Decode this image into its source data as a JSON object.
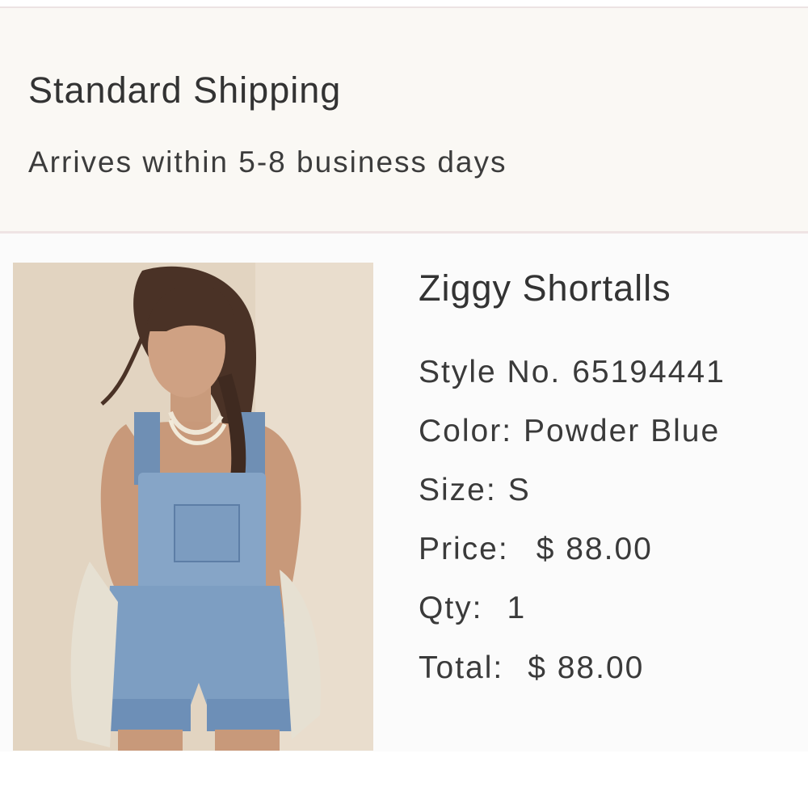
{
  "shipping": {
    "title": "Standard Shipping",
    "subtitle": "Arrives within 5-8 business days"
  },
  "product": {
    "name": "Ziggy Shortalls",
    "image": "model-wearing-denim-shortalls-photo",
    "style": {
      "label": "Style No.",
      "value": "65194441"
    },
    "color": {
      "label": "Color:",
      "value": "Powder Blue"
    },
    "size": {
      "label": "Size:",
      "value": "S"
    },
    "price": {
      "label": "Price:",
      "value": "$ 88.00"
    },
    "qty": {
      "label": "Qty:",
      "value": "1"
    },
    "total": {
      "label": "Total:",
      "value": "$ 88.00"
    }
  },
  "colors": {
    "shipping_bg": "#faf8f4",
    "text": "#333333",
    "denim": "#7d9ec2"
  }
}
